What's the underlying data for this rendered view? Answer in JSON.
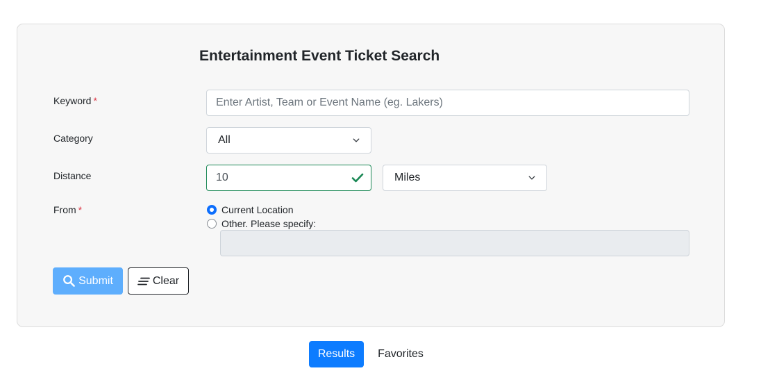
{
  "form": {
    "title": "Entertainment Event Ticket Search",
    "keyword": {
      "label": "Keyword",
      "required_mark": "*",
      "placeholder": "Enter Artist, Team or Event Name (eg. Lakers)",
      "value": ""
    },
    "category": {
      "label": "Category",
      "selected": "All"
    },
    "distance": {
      "label": "Distance",
      "value": "10",
      "unit_selected": "Miles",
      "valid": true
    },
    "from": {
      "label": "From",
      "required_mark": "*",
      "options": [
        "Current Location",
        "Other. Please specify:"
      ],
      "selected_index": 0,
      "other_value": ""
    },
    "buttons": {
      "submit": "Submit",
      "clear": "Clear"
    }
  },
  "tabs": [
    {
      "label": "Results",
      "active": true
    },
    {
      "label": "Favorites",
      "active": false
    }
  ],
  "colors": {
    "submit_bg": "#5eaefd",
    "active_tab_bg": "#0d7cff",
    "required": "#dc3545",
    "valid": "#198754",
    "radio_checked": "#0d6efd"
  }
}
